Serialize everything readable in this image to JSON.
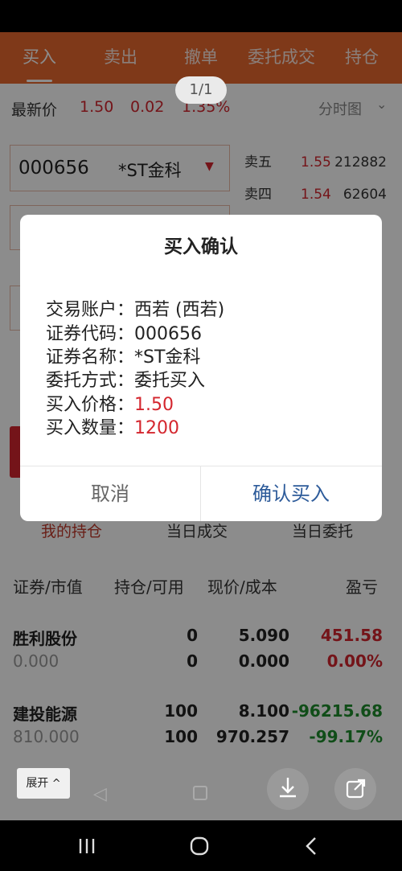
{
  "tabs": [
    "买入",
    "卖出",
    "撤单",
    "委托成交",
    "持仓"
  ],
  "pager": "1/1",
  "price": {
    "label": "最新价",
    "last": "1.50",
    "change": "0.02",
    "pct": "1.35%",
    "chart_mode": "分时图"
  },
  "stock": {
    "code": "000656",
    "name": "*ST金科"
  },
  "orderbook": [
    {
      "label": "卖五",
      "price": "1.55",
      "vol": "212882"
    },
    {
      "label": "卖四",
      "price": "1.54",
      "vol": "62604"
    }
  ],
  "hold_tabs": [
    "我的持仓",
    "当日成交",
    "当日委托"
  ],
  "list_header": {
    "col1": "证券/市值",
    "col2": "持仓/可用",
    "col3": "现价/成本",
    "col4": "盈亏"
  },
  "holdings": [
    {
      "name": "胜利股份",
      "value": "0.000",
      "hold": "0",
      "avail": "0",
      "price": "5.090",
      "cost": "0.000",
      "pnl": "451.58",
      "pnl_pct": "0.00%",
      "pnl_color": "red"
    },
    {
      "name": "建投能源",
      "value": "810.000",
      "hold": "100",
      "avail": "100",
      "price": "8.100",
      "cost": "970.257",
      "pnl": "-96215.68",
      "pnl_pct": "-99.17%",
      "pnl_color": "green"
    }
  ],
  "expand_label": "展开",
  "dialog": {
    "title": "买入确认",
    "rows": [
      {
        "label": "交易账户：",
        "value": "西若 (西若)",
        "highlight": false
      },
      {
        "label": "证券代码：",
        "value": "000656",
        "highlight": false
      },
      {
        "label": "证券名称：",
        "value": "*ST金科",
        "highlight": false
      },
      {
        "label": "委托方式：",
        "value": "委托买入",
        "highlight": false
      },
      {
        "label": "买入价格：",
        "value": "1.50",
        "highlight": true
      },
      {
        "label": "买入数量：",
        "value": "1200",
        "highlight": true
      }
    ],
    "cancel": "取消",
    "confirm": "确认买入"
  }
}
